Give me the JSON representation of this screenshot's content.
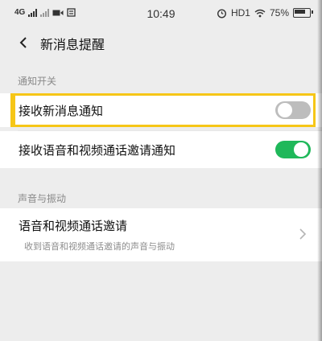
{
  "status_bar": {
    "network": "4G",
    "time": "10:49",
    "hd_label": "HD1",
    "battery": "75%"
  },
  "nav": {
    "title": "新消息提醒"
  },
  "sections": {
    "notify_switch": {
      "header": "通知开关",
      "rows": [
        {
          "label": "接收新消息通知",
          "toggle": "off"
        },
        {
          "label": "接收语音和视频通话邀请通知",
          "toggle": "on"
        }
      ]
    },
    "sound_vibration": {
      "header": "声音与振动",
      "rows": [
        {
          "label": "语音和视频通话邀请",
          "subtitle": "收到语音和视频通话邀请的声音与振动"
        }
      ]
    }
  },
  "colors": {
    "toggle_on": "#1fb85a",
    "toggle_off": "#bdbdbd",
    "highlight": "#f6c617",
    "background": "#ededed"
  }
}
